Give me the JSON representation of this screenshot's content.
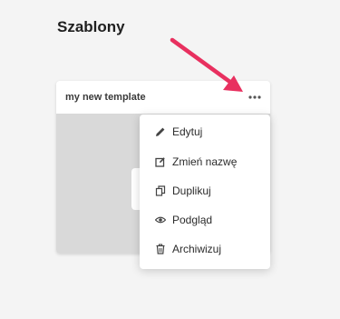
{
  "page": {
    "title": "Szablony"
  },
  "card": {
    "title": "my new template"
  },
  "menu": {
    "items": [
      {
        "label": "Edytuj",
        "icon": "pencil-icon"
      },
      {
        "label": "Zmień nazwę",
        "icon": "edit-box-icon"
      },
      {
        "label": "Duplikuj",
        "icon": "copy-icon"
      },
      {
        "label": "Podgląd",
        "icon": "eye-icon"
      },
      {
        "label": "Archiwizuj",
        "icon": "trash-icon"
      }
    ]
  },
  "colors": {
    "accent_arrow": "#e8305f",
    "background": "#f4f4f4"
  }
}
